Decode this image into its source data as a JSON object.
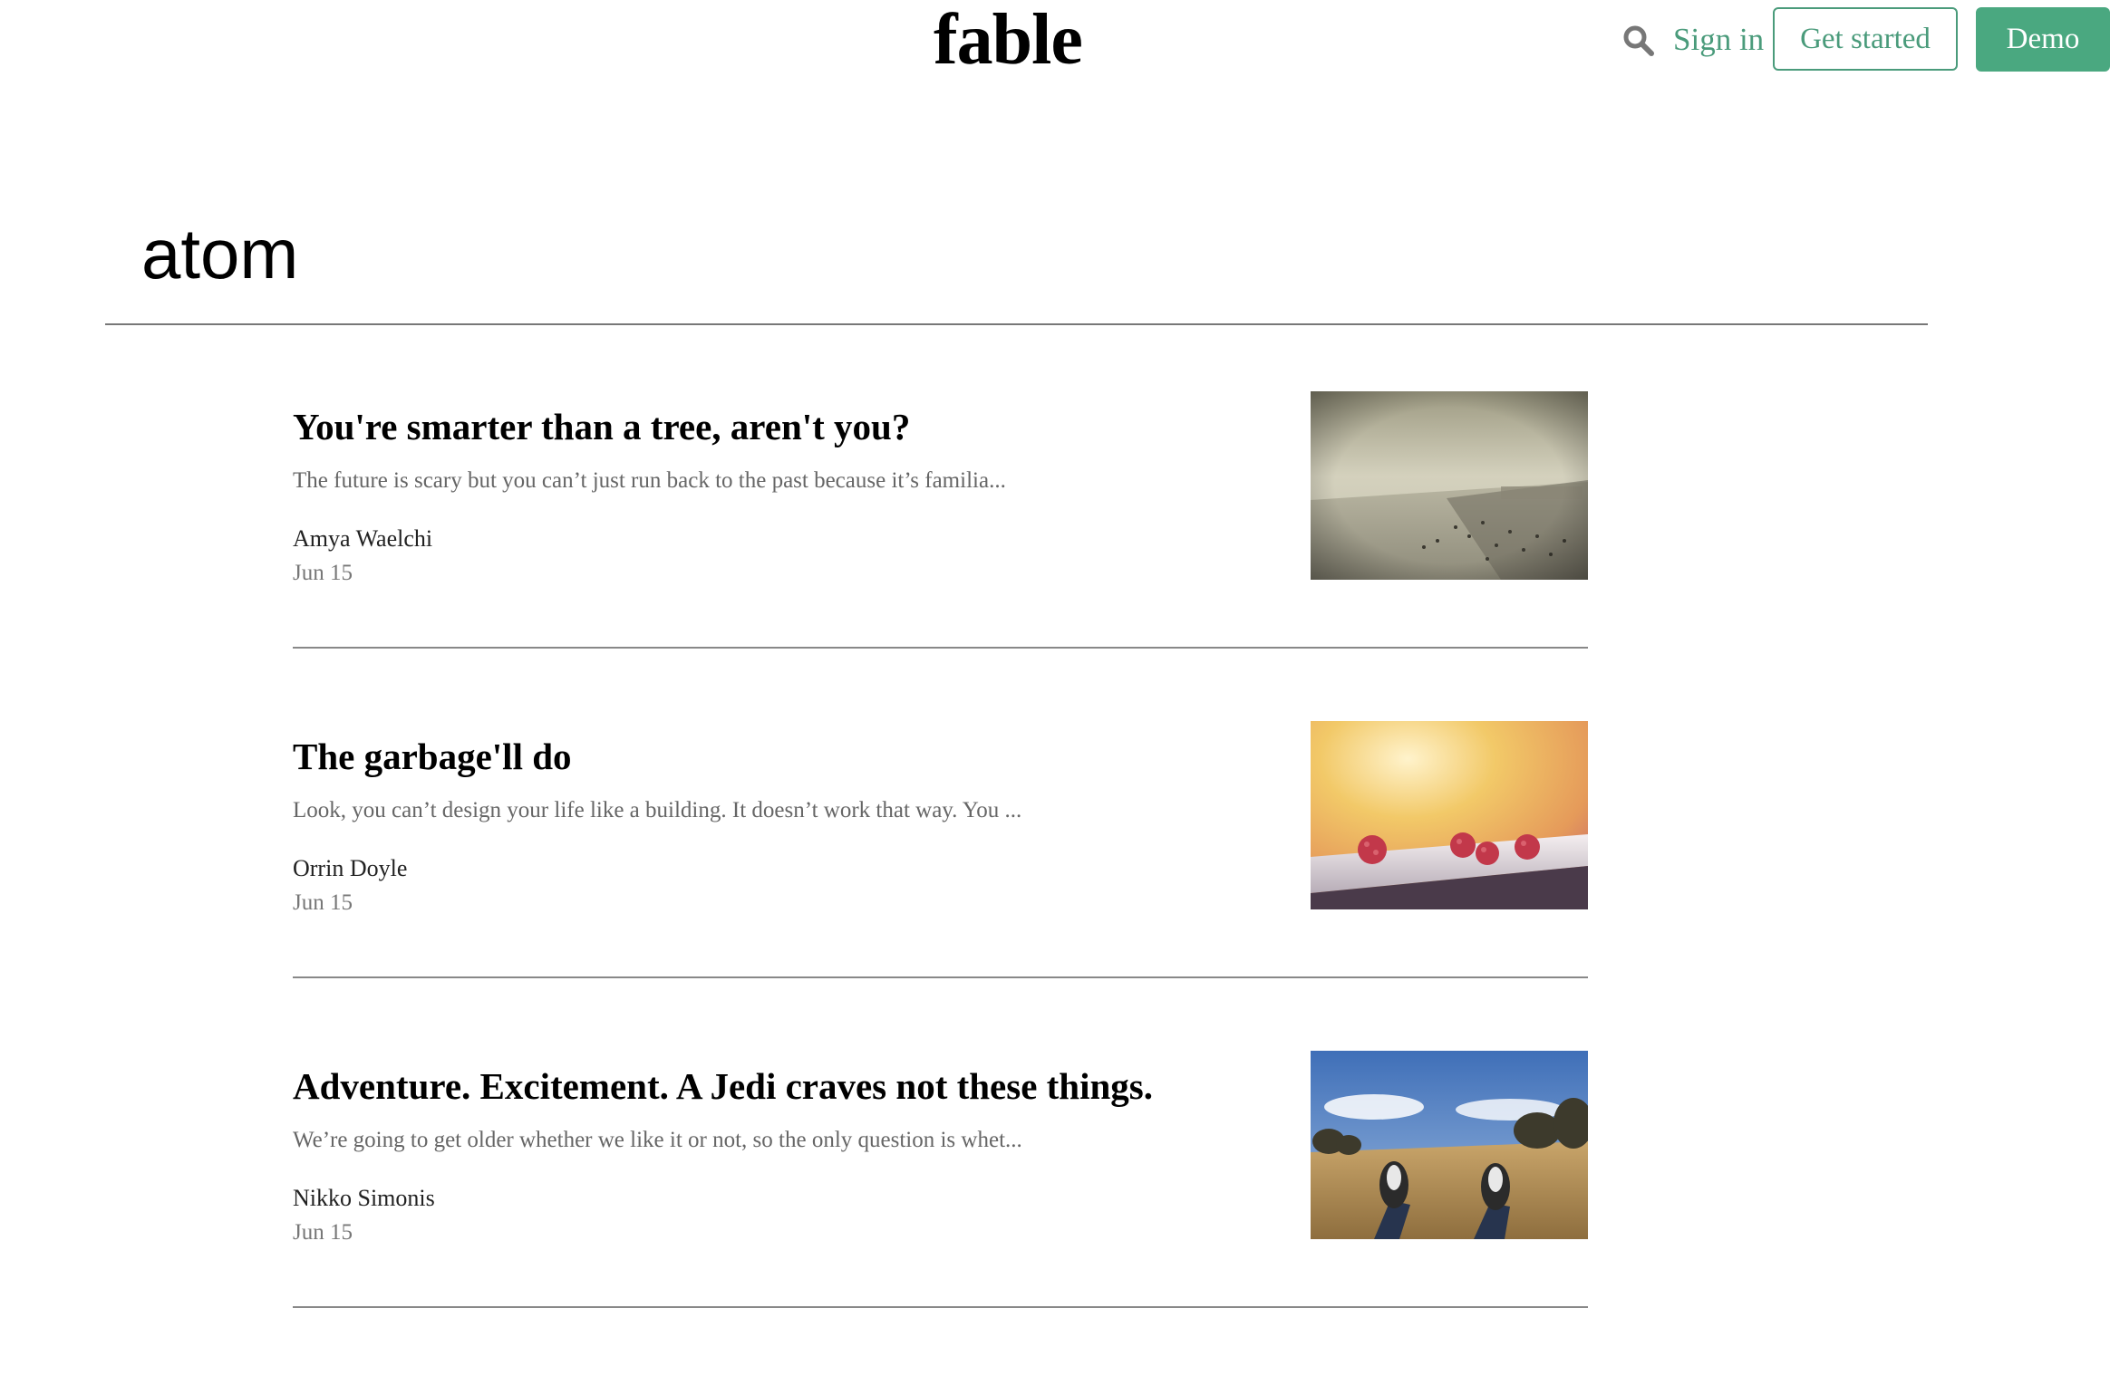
{
  "header": {
    "logo": "fable",
    "search_icon": "search-icon",
    "sign_in": "Sign in",
    "get_started": "Get started",
    "demo": "Demo",
    "accent_color": "#4a9b7b"
  },
  "page": {
    "title": "atom"
  },
  "posts": [
    {
      "title": "You're smarter than a tree, aren't you?",
      "excerpt": "The future is scary but you can’t just run back to the past because it’s familia...",
      "author": "Amya Waelchi",
      "date": "Jun 15"
    },
    {
      "title": "The garbage'll do",
      "excerpt": "Look, you can’t design your life like a building. It doesn’t work that way. You ...",
      "author": "Orrin Doyle",
      "date": "Jun 15"
    },
    {
      "title": "Adventure. Excitement. A Jedi craves not these things.",
      "excerpt": "We’re going to get older whether we like it or not, so the only question is whet...",
      "author": "Nikko Simonis",
      "date": "Jun 15"
    }
  ]
}
